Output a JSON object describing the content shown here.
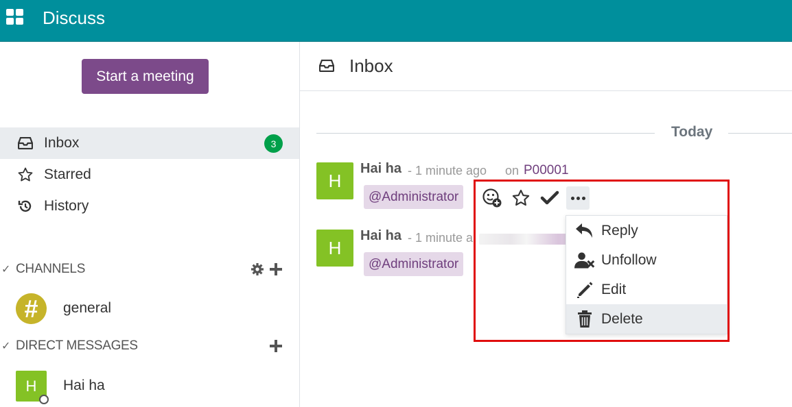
{
  "app": {
    "title": "Discuss",
    "icon": "apps-grid-icon"
  },
  "sidebar": {
    "start_meeting_label": "Start a meeting",
    "mailboxes": [
      {
        "label": "Inbox",
        "icon": "inbox-icon",
        "badge": "3",
        "active": true
      },
      {
        "label": "Starred",
        "icon": "star-icon"
      },
      {
        "label": "History",
        "icon": "history-icon"
      }
    ],
    "channels": {
      "title": "CHANNELS",
      "items": [
        {
          "name": "general",
          "icon": "#"
        }
      ]
    },
    "direct_messages": {
      "title": "DIRECT MESSAGES",
      "items": [
        {
          "name": "Hai ha",
          "initial": "H"
        }
      ]
    }
  },
  "main": {
    "title": "Inbox",
    "day_separator": "Today",
    "messages": [
      {
        "initial": "H",
        "author": "Hai ha",
        "date": "- 1 minute ago",
        "on": "on",
        "record": "P00001",
        "mention": "@Administrator"
      },
      {
        "initial": "H",
        "author": "Hai ha",
        "date": "- 1 minute a",
        "mention": "@Administrator"
      }
    ]
  },
  "actions": {
    "icons": [
      "add-reaction-icon",
      "star-icon",
      "check-icon",
      "more-dots-icon"
    ],
    "menu": [
      {
        "label": "Reply",
        "icon": "reply-icon"
      },
      {
        "label": "Unfollow",
        "icon": "unfollow-user-icon"
      },
      {
        "label": "Edit",
        "icon": "pencil-icon"
      },
      {
        "label": "Delete",
        "icon": "trash-icon"
      }
    ]
  },
  "colors": {
    "topbar": "#008f9c",
    "primary": "#7c4a8a",
    "badge": "#00a04a",
    "avatar": "#84c225",
    "channel_avatar": "#c6b42a",
    "highlight": "#e00d0d"
  }
}
